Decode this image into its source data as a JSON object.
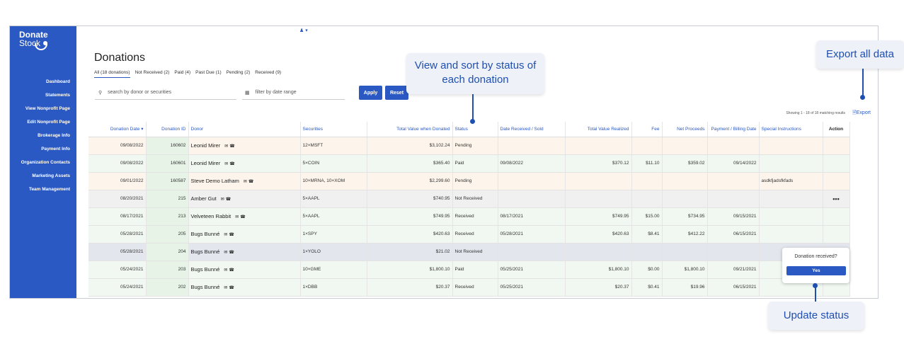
{
  "sidebar": {
    "logo_line1": "Donate",
    "logo_line2": "Stock",
    "items": [
      "Dashboard",
      "Statements",
      "View Nonprofit Page",
      "Edit Nonprofit Page",
      "Brokerage Info",
      "Payment Info",
      "Organization Contacts",
      "Marketing Assets",
      "Team Management"
    ]
  },
  "header": {
    "user_icon": "user-icon"
  },
  "page": {
    "title": "Donations"
  },
  "tabs": [
    "All (18 donations)",
    "Not Received (2)",
    "Paid (4)",
    "Past Due (1)",
    "Pending (2)",
    "Received (9)"
  ],
  "search": {
    "placeholder": "search by donor or securities"
  },
  "date_filter": {
    "placeholder": "filter by date range"
  },
  "buttons": {
    "apply": "Apply",
    "reset": "Reset",
    "export": "Export"
  },
  "showing": "Showing 1 - 18 of 18 matching results",
  "table": {
    "columns": [
      "Donation Date",
      "Donation ID",
      "Donor",
      "Securities",
      "Total Value when Donated",
      "Status",
      "Date Received / Sold",
      "Total Value Realized",
      "Fee",
      "Net Proceeds",
      "Payment / Billing Date",
      "Special Instructions",
      "Action"
    ],
    "rows": [
      {
        "date": "09/08/2022",
        "id": "160602",
        "donor": "Leonid Mirer",
        "securities": "12×MSFT",
        "value": "$3,102.24",
        "status": "Pending",
        "received": "",
        "realized": "",
        "fee": "",
        "net": "",
        "billing": "",
        "instructions": "",
        "action": ""
      },
      {
        "date": "09/08/2022",
        "id": "160601",
        "donor": "Leonid Mirer",
        "securities": "5×COIN",
        "value": "$365.40",
        "status": "Paid",
        "received": "09/08/2022",
        "realized": "$370.12",
        "fee": "$11.10",
        "net": "$359.02",
        "billing": "09/14/2022",
        "instructions": "",
        "action": ""
      },
      {
        "date": "09/01/2022",
        "id": "160587",
        "donor": "Steve Demo Latham",
        "securities": "10×MRNA, 10×XOM",
        "value": "$2,299.60",
        "status": "Pending",
        "received": "",
        "realized": "",
        "fee": "",
        "net": "",
        "billing": "",
        "instructions": "asdkfjadsfkfads",
        "action": ""
      },
      {
        "date": "08/20/2021",
        "id": "215",
        "donor": "Amber Gut",
        "securities": "5×AAPL",
        "value": "$740.95",
        "status": "Not Received",
        "received": "",
        "realized": "",
        "fee": "",
        "net": "",
        "billing": "",
        "instructions": "",
        "action": "•••"
      },
      {
        "date": "08/17/2021",
        "id": "213",
        "donor": "Velveteen Rabbit",
        "securities": "5×AAPL",
        "value": "$749.95",
        "status": "Received",
        "received": "08/17/2021",
        "realized": "$749.95",
        "fee": "$15.00",
        "net": "$734.95",
        "billing": "09/15/2021",
        "instructions": "",
        "action": ""
      },
      {
        "date": "05/28/2021",
        "id": "205",
        "donor": "Bugs Bunné",
        "securities": "1×SPY",
        "value": "$420.63",
        "status": "Received",
        "received": "05/28/2021",
        "realized": "$420.63",
        "fee": "$8.41",
        "net": "$412.22",
        "billing": "06/15/2021",
        "instructions": "",
        "action": ""
      },
      {
        "date": "05/28/2021",
        "id": "204",
        "donor": "Bugs Bunné",
        "securities": "1×YOLO",
        "value": "$21.02",
        "status": "Not Received",
        "received": "",
        "realized": "",
        "fee": "",
        "net": "",
        "billing": "",
        "instructions": "",
        "action": "•••"
      },
      {
        "date": "05/24/2021",
        "id": "203",
        "donor": "Bugs Bunné",
        "securities": "10×GME",
        "value": "$1,800.10",
        "status": "Paid",
        "received": "05/25/2021",
        "realized": "$1,800.10",
        "fee": "$0.00",
        "net": "$1,800.10",
        "billing": "09/21/2021",
        "instructions": "",
        "action": ""
      },
      {
        "date": "05/24/2021",
        "id": "202",
        "donor": "Bugs Bunné",
        "securities": "1×DBB",
        "value": "$20.37",
        "status": "Received",
        "received": "05/25/2021",
        "realized": "$20.37",
        "fee": "$0.41",
        "net": "$19.96",
        "billing": "06/15/2021",
        "instructions": "",
        "action": ""
      }
    ]
  },
  "popover": {
    "question": "Donation received?",
    "yes": "Yes"
  },
  "callouts": {
    "status": "View and sort by status of each donation",
    "export": "Export all data",
    "update": "Update status"
  },
  "colors": {
    "brand": "#2b59c3",
    "callout_text": "#1f4fb0"
  }
}
